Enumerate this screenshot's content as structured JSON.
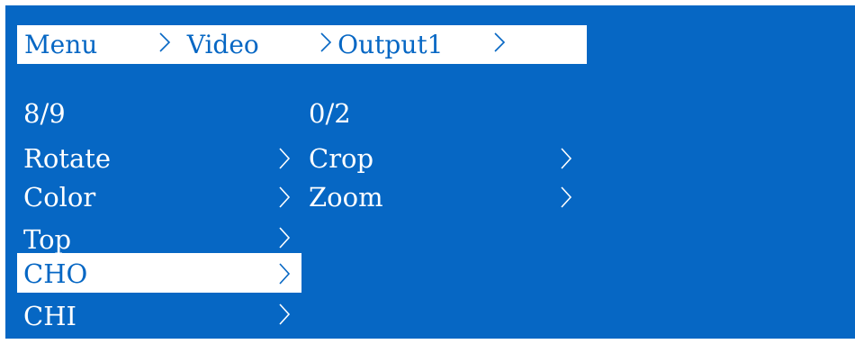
{
  "breadcrumb": {
    "items": [
      "Menu",
      "Video",
      "Output1"
    ],
    "separator": ">"
  },
  "left_panel": {
    "page_indicator": "8/9",
    "items": [
      {
        "label": "Rotate"
      },
      {
        "label": "Color"
      },
      {
        "label": "Top"
      },
      {
        "label": "CHO",
        "selected": true
      },
      {
        "label": "CHI"
      }
    ]
  },
  "right_panel": {
    "page_indicator": "0/2",
    "items": [
      {
        "label": "Crop"
      },
      {
        "label": "Zoom"
      }
    ]
  },
  "colors": {
    "background": "#0667c4",
    "text": "#ffffff",
    "highlight": "#ffffff",
    "highlight_text": "#0667c4"
  },
  "icons": [
    "chevron-right-icon"
  ]
}
